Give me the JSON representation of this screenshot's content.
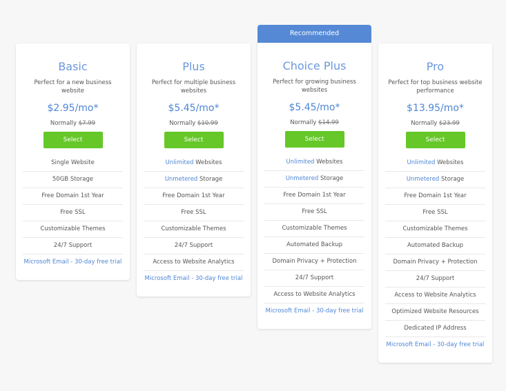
{
  "recommended_label": "Recommended",
  "colors": {
    "accent_blue": "#4e86d4",
    "banner_blue": "#5589d6",
    "select_green": "#65c728",
    "background": "#f7f7f7"
  },
  "plans": [
    {
      "name": "Basic",
      "description": "Perfect for a new business website",
      "price": "$2.95/mo*",
      "normally_label": "Normally",
      "normal_price": "$7.99",
      "select_label": "Select",
      "recommended": false,
      "features": [
        {
          "highlight": "",
          "text": "Single Website"
        },
        {
          "highlight": "",
          "text": "50GB Storage"
        },
        {
          "highlight": "",
          "text": "Free Domain 1st Year"
        },
        {
          "highlight": "",
          "text": "Free SSL"
        },
        {
          "highlight": "",
          "text": "Customizable Themes"
        },
        {
          "highlight": "",
          "text": "24/7 Support"
        }
      ],
      "trial_link": "Microsoft Email - 30-day free trial"
    },
    {
      "name": "Plus",
      "description": "Perfect for multiple business websites",
      "price": "$5.45/mo*",
      "normally_label": "Normally",
      "normal_price": "$10.99",
      "select_label": "Select",
      "recommended": false,
      "features": [
        {
          "highlight": "Unlimited",
          "text": " Websites"
        },
        {
          "highlight": "Unmetered",
          "text": " Storage"
        },
        {
          "highlight": "",
          "text": "Free Domain 1st Year"
        },
        {
          "highlight": "",
          "text": "Free SSL"
        },
        {
          "highlight": "",
          "text": "Customizable Themes"
        },
        {
          "highlight": "",
          "text": "24/7 Support"
        },
        {
          "highlight": "",
          "text": "Access to Website Analytics"
        }
      ],
      "trial_link": "Microsoft Email - 30-day free trial"
    },
    {
      "name": "Choice Plus",
      "description": "Perfect for growing business websites",
      "price": "$5.45/mo*",
      "normally_label": "Normally",
      "normal_price": "$14.99",
      "select_label": "Select",
      "recommended": true,
      "features": [
        {
          "highlight": "Unlimited",
          "text": " Websites"
        },
        {
          "highlight": "Unmetered",
          "text": " Storage"
        },
        {
          "highlight": "",
          "text": "Free Domain 1st Year"
        },
        {
          "highlight": "",
          "text": "Free SSL"
        },
        {
          "highlight": "",
          "text": "Customizable Themes"
        },
        {
          "highlight": "",
          "text": "Automated Backup"
        },
        {
          "highlight": "",
          "text": "Domain Privacy + Protection"
        },
        {
          "highlight": "",
          "text": "24/7 Support"
        },
        {
          "highlight": "",
          "text": "Access to Website Analytics"
        }
      ],
      "trial_link": "Microsoft Email - 30-day free trial"
    },
    {
      "name": "Pro",
      "description": "Perfect for top business website performance",
      "price": "$13.95/mo*",
      "normally_label": "Normally",
      "normal_price": "$23.99",
      "select_label": "Select",
      "recommended": false,
      "features": [
        {
          "highlight": "Unlimited",
          "text": " Websites"
        },
        {
          "highlight": "Unmetered",
          "text": " Storage"
        },
        {
          "highlight": "",
          "text": "Free Domain 1st Year"
        },
        {
          "highlight": "",
          "text": "Free SSL"
        },
        {
          "highlight": "",
          "text": "Customizable Themes"
        },
        {
          "highlight": "",
          "text": "Automated Backup"
        },
        {
          "highlight": "",
          "text": "Domain Privacy + Protection"
        },
        {
          "highlight": "",
          "text": "24/7 Support"
        },
        {
          "highlight": "",
          "text": "Access to Website Analytics"
        },
        {
          "highlight": "",
          "text": "Optimized Website Resources"
        },
        {
          "highlight": "",
          "text": "Dedicated IP Address"
        }
      ],
      "trial_link": "Microsoft Email - 30-day free trial"
    }
  ]
}
